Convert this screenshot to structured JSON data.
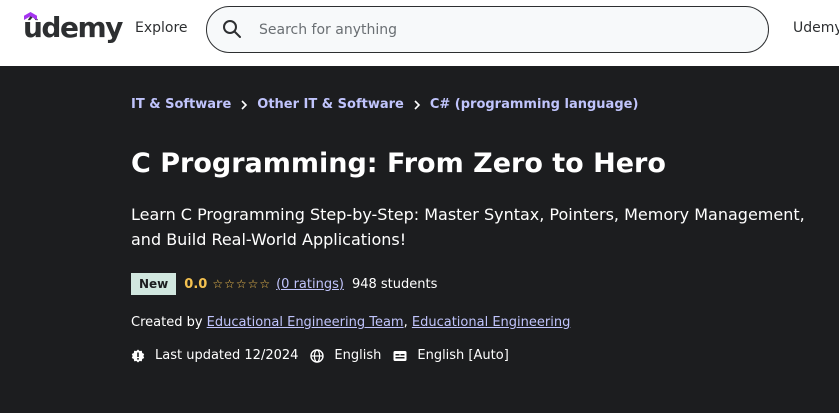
{
  "header": {
    "logo_text": "ûdemy",
    "explore_label": "Explore",
    "search_placeholder": "Search for anything",
    "right_link": "Udemy"
  },
  "breadcrumb": {
    "items": [
      "IT & Software",
      "Other IT & Software",
      "C# (programming language)"
    ],
    "separator_icon": "chevron-right-icon"
  },
  "course": {
    "title": "C Programming: From Zero to Hero",
    "subtitle": "Learn C Programming Step-by-Step: Master Syntax, Pointers, Memory Management, and Build Real-World Applications!",
    "badge": "New",
    "rating": "0.0",
    "stars": "☆☆☆☆☆",
    "stars_filled": 0,
    "ratings_link": "(0 ratings)",
    "students": "948 students",
    "created_by_label": "Created by",
    "instructors": [
      "Educational Engineering Team",
      "Educational Engineering"
    ],
    "instructor_separator": ",",
    "last_updated": "Last updated 12/2024",
    "language": "English",
    "captions": "English [Auto]"
  },
  "colors": {
    "hero_bg": "#1c1d1f",
    "link": "#c0c4fc",
    "star": "#f4c150",
    "badge_bg": "#d1e7df",
    "logo_accent": "#a435f0"
  }
}
